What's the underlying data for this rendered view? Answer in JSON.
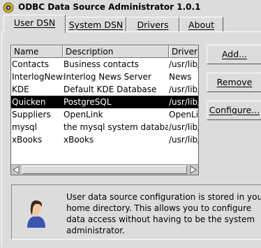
{
  "window": {
    "title": "ODBC Data Source Administrator 1.0.1"
  },
  "tabs": [
    {
      "label": "User DSN",
      "active": true
    },
    {
      "label": "System DSN",
      "active": false
    },
    {
      "label": "Drivers",
      "active": false
    },
    {
      "label": "About",
      "active": false
    }
  ],
  "list": {
    "columns": [
      "Name",
      "Description",
      "Driver"
    ],
    "rows": [
      {
        "name": "Contacts",
        "description": "Business contacts",
        "driver": "/usr/lib/"
      },
      {
        "name": "InterlogNews",
        "description": "Interlog News Server",
        "driver": "News"
      },
      {
        "name": "KDE",
        "description": "Default KDE Database",
        "driver": "/usr/lib/"
      },
      {
        "name": "Quicken",
        "description": "PostgreSQL",
        "driver": "/usr/lib/",
        "selected": true
      },
      {
        "name": "Suppliers",
        "description": "OpenLink",
        "driver": "OpenLi"
      },
      {
        "name": "mysql",
        "description": "the mysql system database",
        "driver": "/usr/lib/"
      },
      {
        "name": "xBooks",
        "description": "xBooks",
        "driver": "/usr/lib/"
      }
    ]
  },
  "buttons": {
    "add": "Add...",
    "remove": "Remove",
    "configure": "Configure..."
  },
  "info": {
    "text": "User data source configuration is stored in your home directory. This allows you to configure data access without having to be the system administrator.",
    "icon": "user-icon"
  },
  "colors": {
    "background": "#dcdcdc",
    "selection": "#000000",
    "list_background": "#ffffff"
  }
}
